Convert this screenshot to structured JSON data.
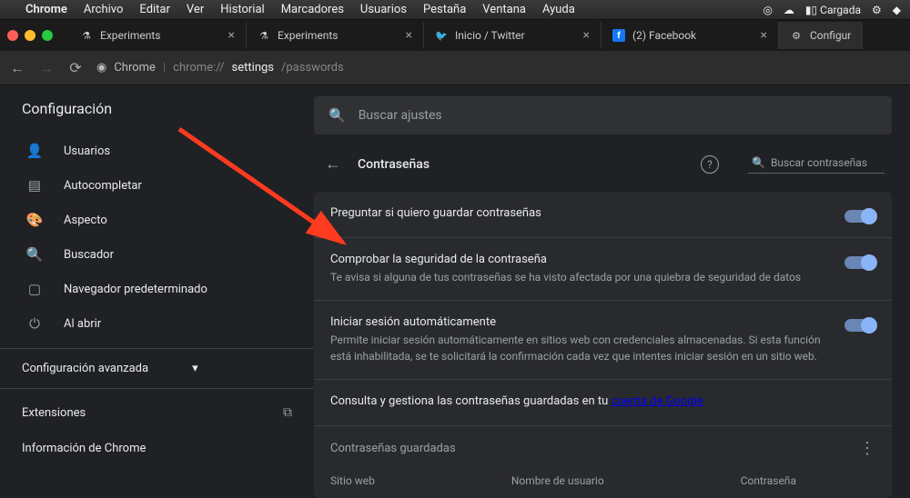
{
  "menubar": {
    "app": "Chrome",
    "items": [
      "Archivo",
      "Editar",
      "Ver",
      "Historial",
      "Marcadores",
      "Usuarios",
      "Pestaña",
      "Ventana",
      "Ayuda"
    ],
    "battery": "Cargada"
  },
  "tabs": [
    {
      "label": "Experiments",
      "icon": "flask"
    },
    {
      "label": "Experiments",
      "icon": "flask"
    },
    {
      "label": "Inicio / Twitter",
      "icon": "twitter"
    },
    {
      "label": "(2) Facebook",
      "icon": "facebook"
    },
    {
      "label": "Configur",
      "icon": "gear"
    }
  ],
  "toolbar": {
    "product": "Chrome",
    "url_prefix": "chrome://",
    "url_mid": "settings",
    "url_suffix": "/passwords"
  },
  "sidebar": {
    "title": "Configuración",
    "items": [
      {
        "label": "Usuarios"
      },
      {
        "label": "Autocompletar"
      },
      {
        "label": "Aspecto"
      },
      {
        "label": "Buscador"
      },
      {
        "label": "Navegador predeterminado"
      },
      {
        "label": "Al abrir"
      }
    ],
    "advanced": "Configuración avanzada",
    "extensions": "Extensiones",
    "about": "Información de Chrome"
  },
  "main": {
    "search_placeholder": "Buscar ajustes",
    "page_title": "Contraseñas",
    "pwd_search_placeholder": "Buscar contraseñas",
    "settings": [
      {
        "title": "Preguntar si quiero guardar contraseñas",
        "desc": ""
      },
      {
        "title": "Comprobar la seguridad de la contraseña",
        "desc": "Te avisa si alguna de tus contraseñas se ha visto afectada por una quiebra de seguridad de datos"
      },
      {
        "title": "Iniciar sesión automáticamente",
        "desc": "Permite iniciar sesión automáticamente en sitios web con credenciales almacenadas. Si esta función está inhabilitada, se te solicitará la confirmación cada vez que intentes iniciar sesión en un sitio web."
      }
    ],
    "manage_text": "Consulta y gestiona las contraseñas guardadas en tu ",
    "manage_link": "cuenta de Google",
    "saved_title": "Contraseñas guardadas",
    "columns": [
      "Sitio web",
      "Nombre de usuario",
      "Contraseña"
    ]
  }
}
